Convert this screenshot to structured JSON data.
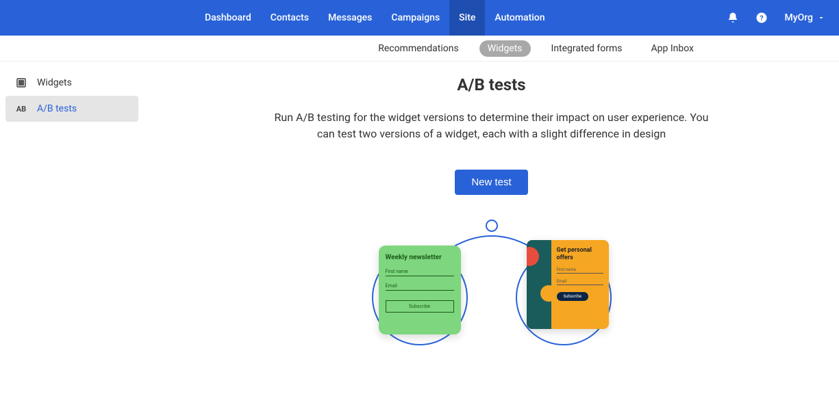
{
  "nav": {
    "items": [
      "Dashboard",
      "Contacts",
      "Messages",
      "Campaigns",
      "Site",
      "Automation"
    ],
    "active_index": 4,
    "org_label": "MyOrg"
  },
  "subtabs": {
    "items": [
      "Recommendations",
      "Widgets",
      "Integrated forms",
      "App Inbox"
    ],
    "active_index": 1
  },
  "sidebar": {
    "items": [
      {
        "icon": "square",
        "label": "Widgets"
      },
      {
        "icon": "AB",
        "label": "A/B tests"
      }
    ],
    "active_index": 1
  },
  "main": {
    "title": "A/B tests",
    "description": "Run A/B testing for the widget versions to determine their impact on user experience. You can test two versions of a widget, each with a slight difference in design",
    "button_label": "New test",
    "card_a": {
      "title": "Weekly newsletter",
      "field1": "First name",
      "field2": "Email",
      "button": "Subscribe"
    },
    "card_b": {
      "title": "Get personal offers",
      "field1": "First name",
      "field2": "Email",
      "button": "Subscribe"
    }
  }
}
